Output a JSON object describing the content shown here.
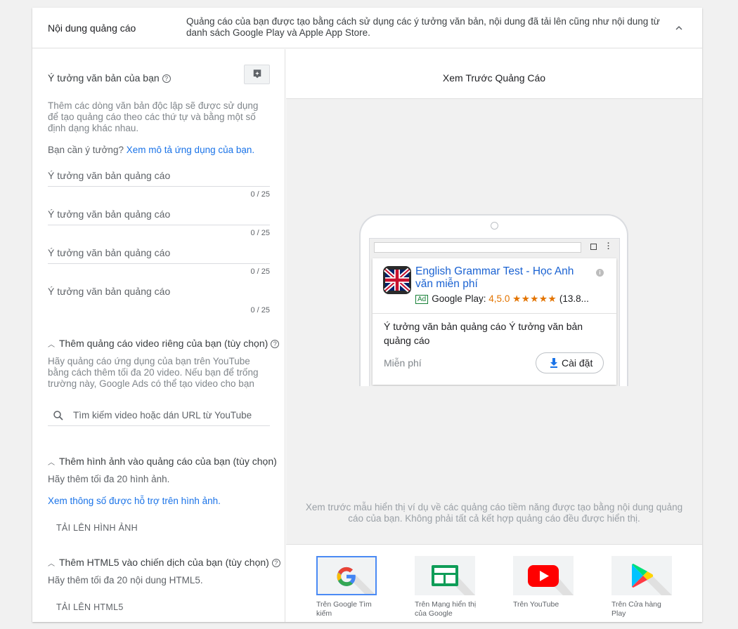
{
  "header": {
    "title": "Nội dung quảng cáo",
    "description": "Quảng cáo của bạn được tạo bằng cách sử dụng các ý tưởng văn bản, nội dung đã tải lên cũng như nội dung từ danh sách Google Play và Apple App Store."
  },
  "text_ideas": {
    "title": "Ý tưởng văn bản của bạn",
    "description": "Thêm các dòng văn bản độc lập sẽ được sử dụng để tạo quảng cáo theo các thứ tự và bằng một số định dạng khác nhau.",
    "need_ideas": "Bạn cần ý tưởng?",
    "need_ideas_link": "Xem mô tả ứng dụng của bạn.",
    "inputs": [
      {
        "placeholder": "Ý tưởng văn bản quảng cáo",
        "counter": "0 / 25"
      },
      {
        "placeholder": "Ý tưởng văn bản quảng cáo",
        "counter": "0 / 25"
      },
      {
        "placeholder": "Ý tưởng văn bản quảng cáo",
        "counter": "0 / 25"
      },
      {
        "placeholder": "Ý tưởng văn bản quảng cáo",
        "counter": "0 / 25"
      }
    ]
  },
  "video": {
    "title": "Thêm quảng cáo video riêng của bạn (tùy chọn)",
    "description": "Hãy quảng cáo ứng dụng của bạn trên YouTube bằng cách thêm tối đa 20 video. Nếu bạn để trống trường này, Google Ads có thể tạo video cho bạn",
    "search_placeholder": "Tìm kiếm video hoặc dán URL từ YouTube"
  },
  "images": {
    "title": "Thêm hình ảnh vào quảng cáo của bạn (tùy chọn)",
    "description": "Hãy thêm tối đa 20 hình ảnh.",
    "link": "Xem thông số được hỗ trợ trên hình ảnh.",
    "upload": "TẢI LÊN HÌNH ẢNH"
  },
  "html5": {
    "title": "Thêm HTML5 vào chiến dịch của bạn (tùy chọn)",
    "description": "Hãy thêm tối đa 20 nội dung HTML5.",
    "upload": "TẢI LÊN HTML5"
  },
  "preview": {
    "title": "Xem Trước Quảng Cáo",
    "ad": {
      "app_title": "English Grammar Test - Học Anh văn miễn phí",
      "badge": "Ad",
      "store": "Google Play:",
      "rating": "4,5.0",
      "stars": "★★★★★",
      "reviews": "(13.8...",
      "body": "Ý tưởng văn bản quảng cáo Ý tưởng văn bản quảng cáo",
      "price": "Miễn phí",
      "install": "Cài đặt"
    },
    "note": "Xem trước mẫu hiển thị ví dụ về các quảng cáo tiềm năng được tạo bằng nội dung quảng cáo của bạn. Không phải tất cả kết hợp quảng cáo đều được hiển thị.",
    "placements": [
      {
        "label": "Trên Google Tìm kiếm",
        "icon": "google-g-icon",
        "selected": true
      },
      {
        "label": "Trên Mạng hiển thị của Google",
        "icon": "display-network-icon",
        "selected": false
      },
      {
        "label": "Trên YouTube",
        "icon": "youtube-icon",
        "selected": false
      },
      {
        "label": "Trên Cửa hàng Play",
        "icon": "google-play-icon",
        "selected": false
      }
    ]
  },
  "colors": {
    "link": "#1a73e8",
    "selected_border": "#4a8af4",
    "rating": "#e37400",
    "ad_badge": "#188038"
  }
}
